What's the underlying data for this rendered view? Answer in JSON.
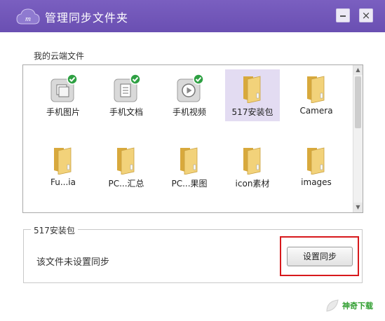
{
  "window": {
    "title": "管理同步文件夹"
  },
  "panel": {
    "label": "我的云端文件"
  },
  "items": [
    {
      "label": "手机图片",
      "icon": "photo-sync-icon",
      "synced": true
    },
    {
      "label": "手机文档",
      "icon": "document-sync-icon",
      "synced": true
    },
    {
      "label": "手机视频",
      "icon": "video-sync-icon",
      "synced": true
    },
    {
      "label": "517安装包",
      "icon": "folder-icon",
      "selected": true
    },
    {
      "label": "Camera",
      "icon": "folder-icon"
    },
    {
      "label": "Fu...ia",
      "icon": "folder-icon"
    },
    {
      "label": "PC...汇总",
      "icon": "folder-icon"
    },
    {
      "label": "PC...果图",
      "icon": "folder-icon"
    },
    {
      "label": "icon素材",
      "icon": "folder-icon"
    },
    {
      "label": "images",
      "icon": "folder-icon"
    }
  ],
  "detail": {
    "title": "517安装包",
    "status": "该文件未设置同步",
    "button_label": "设置同步"
  },
  "watermark": {
    "text": "神奇下载"
  },
  "colors": {
    "titlebar": "#6a4fb2",
    "highlight": "#d7191c",
    "check": "#2ea043",
    "folder": "#e8c15a"
  }
}
